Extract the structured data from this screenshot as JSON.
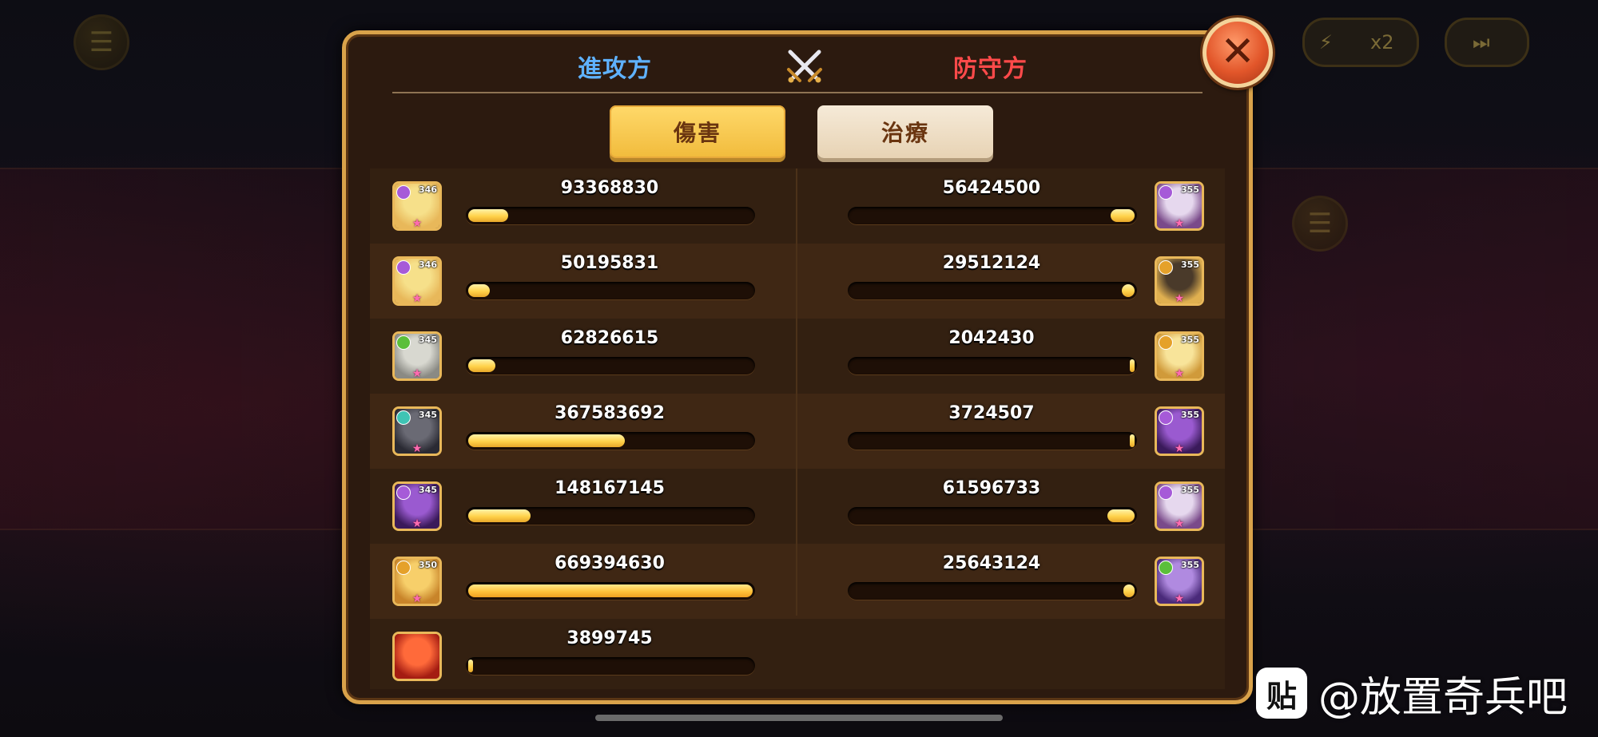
{
  "header": {
    "attacker_label": "進攻方",
    "defender_label": "防守方",
    "tabs": {
      "damage": "傷害",
      "heal": "治療"
    }
  },
  "attackers": [
    {
      "value": "93368830",
      "level": "346",
      "element": "purple",
      "portrait": "blonde-hero",
      "fill_fraction": 0.14
    },
    {
      "value": "50195831",
      "level": "346",
      "element": "purple",
      "portrait": "blonde-hero",
      "fill_fraction": 0.075
    },
    {
      "value": "62826615",
      "level": "345",
      "element": "green",
      "portrait": "wolf-beast",
      "fill_fraction": 0.095
    },
    {
      "value": "367583692",
      "level": "345",
      "element": "teal",
      "portrait": "dark-beast",
      "fill_fraction": 0.55
    },
    {
      "value": "148167145",
      "level": "345",
      "element": "purple",
      "portrait": "purple-dragon",
      "fill_fraction": 0.22
    },
    {
      "value": "669394630",
      "level": "350",
      "element": "gold",
      "portrait": "golden-warrior",
      "fill_fraction": 1.0
    },
    {
      "value": "3899745",
      "level": "",
      "element": "",
      "portrait": "red-dragon-pet",
      "fill_fraction": 0.006
    }
  ],
  "defenders": [
    {
      "value": "56424500",
      "level": "355",
      "element": "purple",
      "portrait": "pale-demon",
      "fill_fraction": 0.085
    },
    {
      "value": "29512124",
      "level": "355",
      "element": "gold",
      "portrait": "dark-witch",
      "fill_fraction": 0.045
    },
    {
      "value": "2042430",
      "level": "355",
      "element": "gold",
      "portrait": "blonde-heroine",
      "fill_fraction": 0.004
    },
    {
      "value": "3724507",
      "level": "355",
      "element": "purple",
      "portrait": "purple-dragon",
      "fill_fraction": 0.006
    },
    {
      "value": "61596733",
      "level": "355",
      "element": "purple",
      "portrait": "pale-demon",
      "fill_fraction": 0.095
    },
    {
      "value": "25643124",
      "level": "355",
      "element": "green",
      "portrait": "violet-mage",
      "fill_fraction": 0.04
    }
  ],
  "colors": {
    "attacker": "#5fb2ff",
    "defender": "#ff4a4a",
    "bar_fill": "#ffd24a",
    "panel_border": "#d9a24a"
  },
  "watermark": {
    "logo": "贴",
    "text": "@放置奇兵吧"
  },
  "background": {
    "speed_label": "x2"
  }
}
